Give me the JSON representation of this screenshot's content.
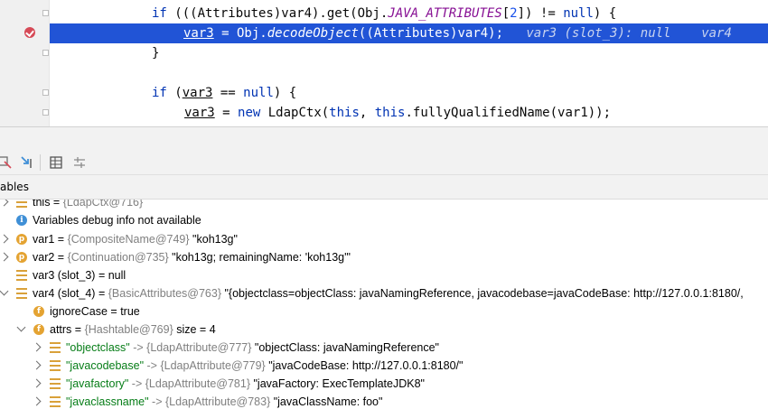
{
  "editor": {
    "lines": [
      {
        "k": "if",
        "a": " (((Attributes)var4).get(Obj.",
        "f": "JAVA_ATTRIBUTES",
        "b": "[",
        "n": "2",
        "c": "]) != ",
        "k2": "null",
        "d": ") {"
      },
      {
        "var": "var3",
        "eq": " = Obj.",
        "m": "decodeObject",
        "rest": "((Attributes)var4);",
        "inline": "var3 (slot_3): null    var4"
      },
      {
        "t": "}"
      },
      {
        "k": "if",
        "a": " (",
        "v": "var3",
        "b": " == ",
        "k2": "null",
        "c": ") {"
      },
      {
        "v": "var3",
        "a": " = ",
        "k": "new",
        "b": " LdapCtx(",
        "k2": "this",
        "c": ", ",
        "k3": "this",
        "d": ".fullyQualifiedName(var1));"
      }
    ]
  },
  "panel": {
    "header_label": "ables"
  },
  "icons": {
    "breakpoint": "breakpoint-hit-icon",
    "toolbar": [
      "restore-layout-icon",
      "step-cursor-icon",
      "evaluate-table-icon",
      "settings-grid-icon"
    ]
  },
  "tree": [
    {
      "name": "this",
      "sep": " = ",
      "type": "{LdapCtx@716}",
      "value": "",
      "icon": "variable-icon",
      "expand": "r"
    },
    {
      "name": "Variables debug info not available",
      "sep": "",
      "type": "",
      "value": "",
      "icon": "info-icon",
      "expand": ""
    },
    {
      "name": "var1",
      "sep": " = ",
      "type": "{CompositeName@749}",
      "value": " \"koh13g\"",
      "icon": "param-icon",
      "expand": "r"
    },
    {
      "name": "var2",
      "sep": " = ",
      "type": "{Continuation@735}",
      "value": " \"koh13g; remainingName: 'koh13g'\"",
      "icon": "param-icon",
      "expand": "r"
    },
    {
      "name": "var3 (slot_3)",
      "sep": " = ",
      "type": "",
      "value": "null",
      "icon": "variable-icon",
      "expand": ""
    },
    {
      "name": "var4 (slot_4)",
      "sep": " = ",
      "type": "{BasicAttributes@763}",
      "value": " \"{objectclass=objectClass: javaNamingReference, javacodebase=javaCodeBase: http://127.0.0.1:8180/,",
      "icon": "variable-icon",
      "expand": "d"
    },
    {
      "name": "ignoreCase",
      "sep": " = ",
      "type": "",
      "value": "true",
      "icon": "field-icon",
      "expand": ""
    },
    {
      "name": "attrs",
      "sep": " = ",
      "type": "{Hashtable@769}",
      "value": "  size = 4",
      "icon": "field-icon",
      "expand": "d"
    },
    {
      "name": "\"objectclass\"",
      "sep": " -> ",
      "type": "{LdapAttribute@777}",
      "value": " \"objectClass: javaNamingReference\"",
      "icon": "entry-icon",
      "expand": "r"
    },
    {
      "name": "\"javacodebase\"",
      "sep": " -> ",
      "type": "{LdapAttribute@779}",
      "value": " \"javaCodeBase: http://127.0.0.1:8180/\"",
      "icon": "entry-icon",
      "expand": "r"
    },
    {
      "name": "\"javafactory\"",
      "sep": " -> ",
      "type": "{LdapAttribute@781}",
      "value": " \"javaFactory: ExecTemplateJDK8\"",
      "icon": "entry-icon",
      "expand": "r"
    },
    {
      "name": "\"javaclassname\"",
      "sep": " -> ",
      "type": "{LdapAttribute@783}",
      "value": " \"javaClassName: foo\"",
      "icon": "entry-icon",
      "expand": "r"
    }
  ]
}
